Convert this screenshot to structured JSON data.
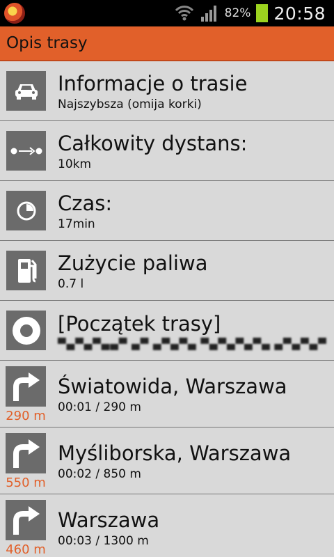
{
  "status": {
    "battery_pct": "82%",
    "time": "20:58"
  },
  "titlebar": {
    "title": "Opis trasy"
  },
  "info_rows": [
    {
      "title": "Informacje o trasie",
      "subtitle": "Najszybsza (omija korki)",
      "icon": "car-icon"
    },
    {
      "title": "Całkowity dystans:",
      "subtitle": "10km",
      "icon": "distance-icon"
    },
    {
      "title": "Czas:",
      "subtitle": "17min",
      "icon": "clock-icon"
    },
    {
      "title": "Zużycie paliwa",
      "subtitle": "0.7 l",
      "icon": "fuel-pump-icon"
    },
    {
      "title": "[Początek trasy]",
      "subtitle": "",
      "icon": "start-point-icon"
    }
  ],
  "steps": [
    {
      "street": "Światowida, Warszawa",
      "detail": "00:01 / 290 m",
      "distance": "290 m",
      "icon": "turn-right-icon"
    },
    {
      "street": "Myśliborska, Warszawa",
      "detail": "00:02 / 850 m",
      "distance": "550 m",
      "icon": "turn-right-icon"
    },
    {
      "street": "Warszawa",
      "detail": "00:03 / 1300 m",
      "distance": "460 m",
      "icon": "turn-right-icon"
    }
  ],
  "colors": {
    "accent": "#e1602a",
    "icon_bg": "#6b6b6b",
    "list_bg": "#d9d9d9"
  }
}
